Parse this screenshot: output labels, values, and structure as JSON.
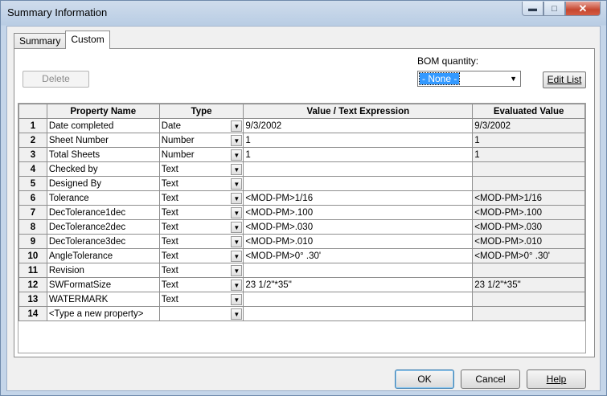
{
  "window": {
    "title": "Summary Information"
  },
  "titlebar": {
    "min_icon": "minimize-icon",
    "max_icon": "maximize-icon",
    "close_icon": "close-icon"
  },
  "tabs": [
    {
      "label": "Summary"
    },
    {
      "label": "Custom"
    }
  ],
  "toolbar": {
    "delete_label": "Delete",
    "bom_label": "BOM quantity:",
    "bom_value": "- None -",
    "edit_list_label": "Edit List"
  },
  "grid": {
    "columns": [
      "Property Name",
      "Type",
      "Value / Text Expression",
      "Evaluated Value"
    ],
    "rows": [
      {
        "num": "1",
        "name": "Date completed",
        "type": "Date",
        "value": "9/3/2002",
        "evaluated": "9/3/2002"
      },
      {
        "num": "2",
        "name": "Sheet Number",
        "type": "Number",
        "value": "1",
        "evaluated": "1"
      },
      {
        "num": "3",
        "name": "Total Sheets",
        "type": "Number",
        "value": "1",
        "evaluated": "1"
      },
      {
        "num": "4",
        "name": "Checked by",
        "type": "Text",
        "value": "",
        "evaluated": ""
      },
      {
        "num": "5",
        "name": "Designed By",
        "type": "Text",
        "value": "",
        "evaluated": ""
      },
      {
        "num": "6",
        "name": "Tolerance",
        "type": "Text",
        "value": "<MOD-PM>1/16",
        "evaluated": "<MOD-PM>1/16"
      },
      {
        "num": "7",
        "name": "DecTolerance1dec",
        "type": "Text",
        "value": " <MOD-PM>.100",
        "evaluated": " <MOD-PM>.100"
      },
      {
        "num": "8",
        "name": "DecTolerance2dec",
        "type": "Text",
        "value": " <MOD-PM>.030",
        "evaluated": " <MOD-PM>.030"
      },
      {
        "num": "9",
        "name": "DecTolerance3dec",
        "type": "Text",
        "value": " <MOD-PM>.010",
        "evaluated": " <MOD-PM>.010"
      },
      {
        "num": "10",
        "name": "AngleTolerance",
        "type": "Text",
        "value": "<MOD-PM>0° .30'",
        "evaluated": "<MOD-PM>0° .30'"
      },
      {
        "num": "11",
        "name": "Revision",
        "type": "Text",
        "value": "",
        "evaluated": ""
      },
      {
        "num": "12",
        "name": "SWFormatSize",
        "type": "Text",
        "value": "23 1/2\"*35\"",
        "evaluated": "23 1/2\"*35\""
      },
      {
        "num": "13",
        "name": "WATERMARK",
        "type": "Text",
        "value": "",
        "evaluated": ""
      },
      {
        "num": "14",
        "name": "<Type a new property>",
        "type": "",
        "value": "",
        "evaluated": ""
      }
    ]
  },
  "footer": {
    "ok_label": "OK",
    "cancel_label": "Cancel",
    "help_label": "Help"
  }
}
